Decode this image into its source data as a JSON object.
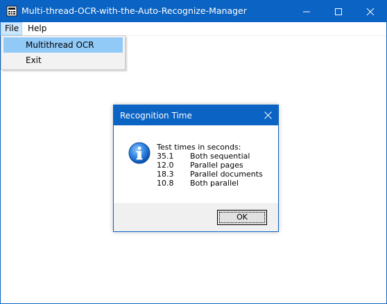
{
  "window": {
    "title": "Multi-thread-OCR-with-the-Auto-Recognize-Manager",
    "app_icon": "app-icon",
    "controls": [
      "minimize-icon",
      "maximize-icon",
      "close-icon"
    ],
    "accent_color": "#0b63c3"
  },
  "menubar": {
    "file_label": "File",
    "help_label": "Help"
  },
  "file_menu": {
    "items": [
      {
        "label": "Multithread OCR",
        "highlighted": true
      },
      {
        "label": "Exit",
        "highlighted": false
      }
    ],
    "highlight_color": "#91c9f7"
  },
  "dialog": {
    "title": "Recognition Time",
    "icon": "info-icon",
    "heading": "Test times in seconds:",
    "rows": [
      {
        "value": "35.1",
        "label": "Both sequential"
      },
      {
        "value": "12.0",
        "label": "Parallel pages"
      },
      {
        "value": "18.3",
        "label": "Parallel documents"
      },
      {
        "value": "10.8",
        "label": "Both parallel"
      }
    ],
    "ok_label": "OK"
  }
}
